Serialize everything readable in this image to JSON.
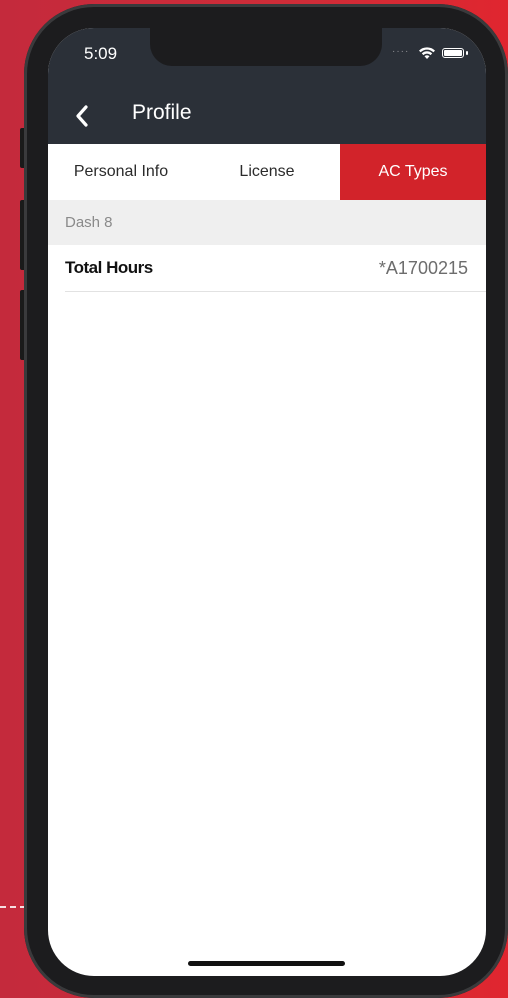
{
  "status_bar": {
    "time": "5:09",
    "signal_icon": "signal-dots-icon",
    "wifi_icon": "wifi-icon",
    "battery_icon": "battery-icon"
  },
  "nav": {
    "back_icon": "chevron-left-icon",
    "title": "Profile"
  },
  "tabs": [
    {
      "label": "Personal Info",
      "active": false
    },
    {
      "label": "License",
      "active": false
    },
    {
      "label": "AC Types",
      "active": true
    }
  ],
  "section": {
    "header": "Dash 8",
    "rows": [
      {
        "label": "Total Hours",
        "value": "*A1700215"
      }
    ]
  },
  "colors": {
    "background": "#cf2c38",
    "navbar": "#2b3038",
    "accent": "#d2232a",
    "section_header_bg": "#efefef"
  }
}
